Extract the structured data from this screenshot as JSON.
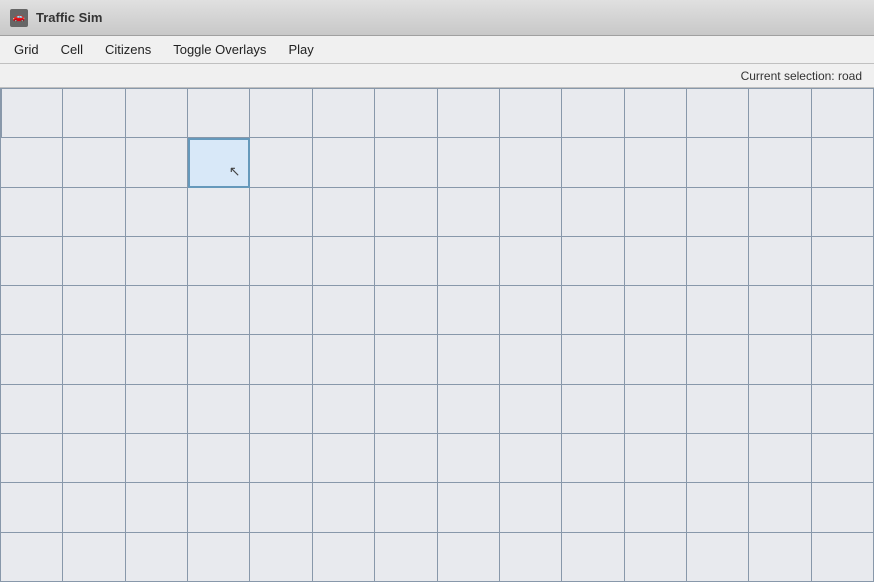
{
  "titleBar": {
    "icon": "🚗",
    "title": "Traffic Sim"
  },
  "menuBar": {
    "items": [
      {
        "id": "grid",
        "label": "Grid"
      },
      {
        "id": "cell",
        "label": "Cell"
      },
      {
        "id": "citizens",
        "label": "Citizens"
      },
      {
        "id": "toggle-overlays",
        "label": "Toggle Overlays"
      },
      {
        "id": "play",
        "label": "Play"
      }
    ]
  },
  "statusBar": {
    "text": "Current selection: road"
  },
  "grid": {
    "cols": 14,
    "rows": 10,
    "selectedCell": {
      "row": 1,
      "col": 3
    }
  }
}
